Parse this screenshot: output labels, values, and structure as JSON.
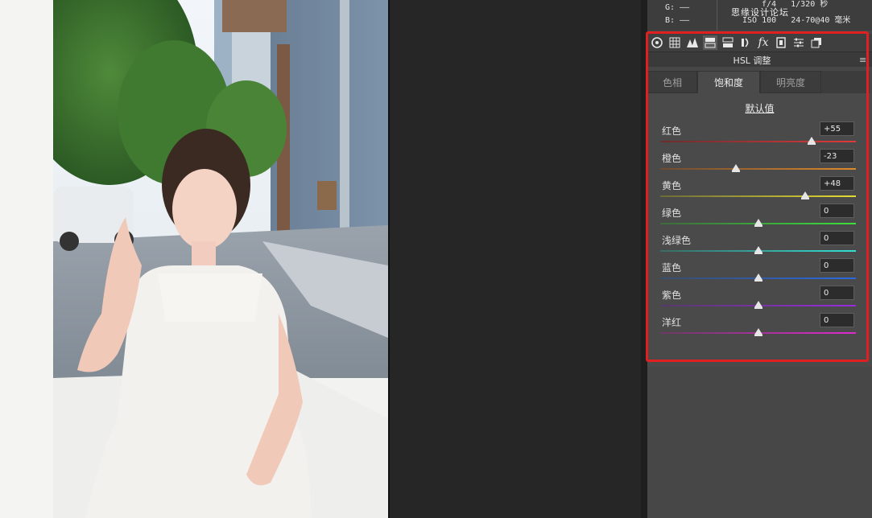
{
  "info": {
    "g_label": "G:",
    "g_value": "——",
    "b_label": "B:",
    "b_value": "——",
    "exposure_top": "f/4   1/320 秒",
    "exposure_bottom": "ISO 100   24-70@40 毫米",
    "watermark": "思缘设计论坛"
  },
  "toolbar": {
    "icons": [
      "aperture-icon",
      "grid-icon",
      "mountains-icon",
      "hsl-icon",
      "split-tone-icon",
      "lens-icon",
      "fx-icon",
      "camera-calibration-icon",
      "presets-icon",
      "snapshots-icon"
    ],
    "fx_glyph": "fx"
  },
  "panel": {
    "title": "HSL 调整",
    "menu_glyph": "≡"
  },
  "tabs": [
    {
      "label": "色相",
      "active": false
    },
    {
      "label": "饱和度",
      "active": true
    },
    {
      "label": "明亮度",
      "active": false
    }
  ],
  "default_link": "默认值",
  "sliders": [
    {
      "label": "红色",
      "value": "+55",
      "position": 55,
      "colors": [
        "#6a2d2d",
        "#e03a3a"
      ]
    },
    {
      "label": "橙色",
      "value": "-23",
      "position": -23,
      "colors": [
        "#6d4a30",
        "#e08a2a"
      ]
    },
    {
      "label": "黄色",
      "value": "+48",
      "position": 48,
      "colors": [
        "#6c6a3a",
        "#e6dc30"
      ]
    },
    {
      "label": "绿色",
      "value": "0",
      "position": 0,
      "colors": [
        "#3d6a3d",
        "#3ce03c"
      ]
    },
    {
      "label": "浅绿色",
      "value": "0",
      "position": 0,
      "colors": [
        "#3a6a66",
        "#30e0d4"
      ]
    },
    {
      "label": "蓝色",
      "value": "0",
      "position": 0,
      "colors": [
        "#3a4d6a",
        "#2a6ae0"
      ]
    },
    {
      "label": "紫色",
      "value": "0",
      "position": 0,
      "colors": [
        "#553a6a",
        "#9a2ae0"
      ]
    },
    {
      "label": "洋红",
      "value": "0",
      "position": 0,
      "colors": [
        "#6a3a62",
        "#e02ad0"
      ]
    }
  ],
  "colors": {
    "highlight": "#e02020",
    "panel_bg": "#4a4a4a"
  }
}
